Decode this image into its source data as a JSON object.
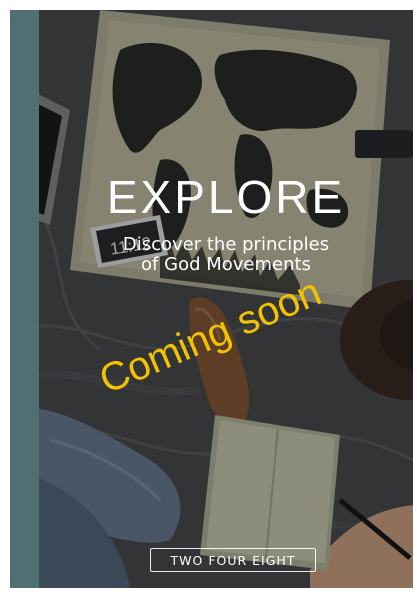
{
  "cover": {
    "title": "EXPLORE",
    "subtitle_line1": "Discover the principles",
    "subtitle_line2": "of God Movements",
    "overlay_text": "Coming soon",
    "brand": "TWO FOUR EIGHT",
    "phone_time": "11:12"
  },
  "colors": {
    "spine": "#4f6f73",
    "overlay_text": "#f3c200",
    "title": "#ffffff"
  }
}
